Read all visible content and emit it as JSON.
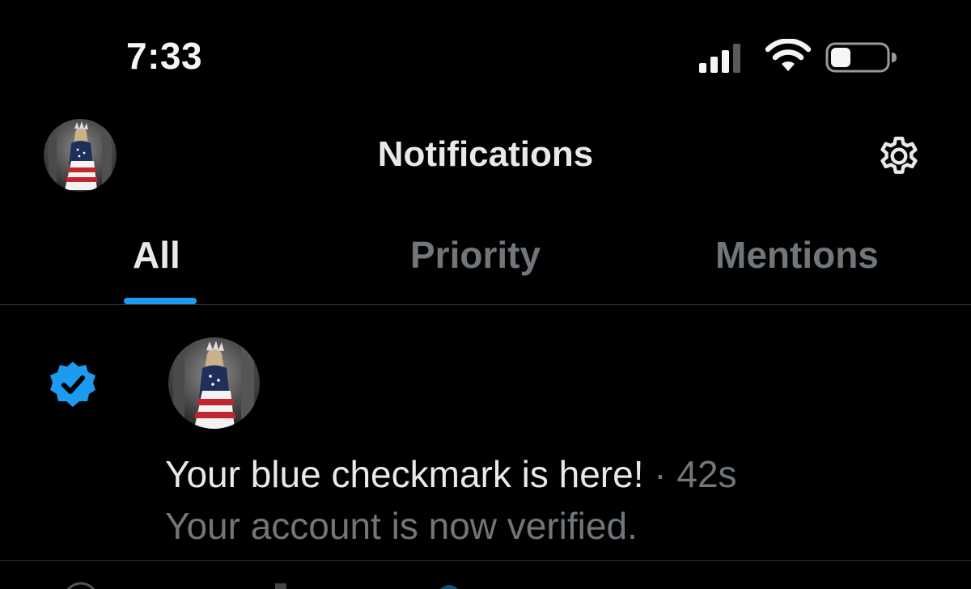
{
  "status_bar": {
    "time": "7:33",
    "icons": [
      "signal-icon",
      "wifi-icon",
      "battery-icon"
    ],
    "battery_level": 0.3
  },
  "header": {
    "title": "Notifications",
    "avatar": "profile-avatar",
    "settings_icon": "gear-icon"
  },
  "tabs": [
    {
      "label": "All",
      "active": true
    },
    {
      "label": "Priority",
      "active": false
    },
    {
      "label": "Mentions",
      "active": false
    }
  ],
  "notification": {
    "badge_icon": "verified-badge-icon",
    "title": "Your blue checkmark is here!",
    "separator": "·",
    "time": "42s",
    "body": "Your account is now verified."
  },
  "colors": {
    "background": "#000000",
    "accent": "#1d9bf0",
    "text_primary": "#e7e9ea",
    "text_secondary": "#71767b",
    "divider": "#2f3336"
  }
}
